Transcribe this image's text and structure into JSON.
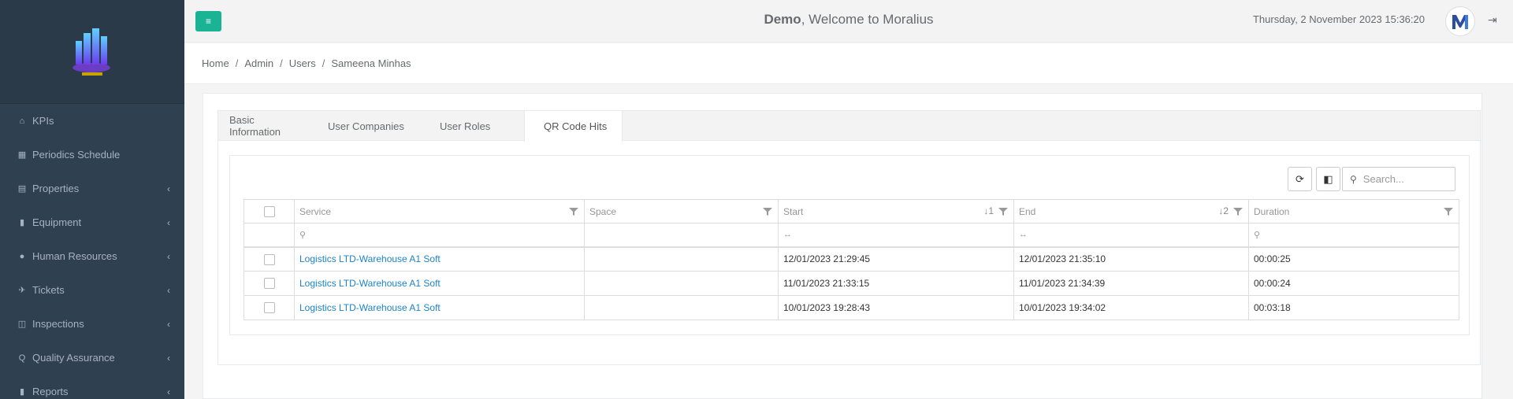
{
  "sidebar": {
    "items": [
      {
        "label": "KPIs",
        "icon": "home-icon",
        "chevron": false
      },
      {
        "label": "Periodics Schedule",
        "icon": "calendar-icon",
        "chevron": false
      },
      {
        "label": "Properties",
        "icon": "building-icon",
        "chevron": true
      },
      {
        "label": "Equipment",
        "icon": "book-icon",
        "chevron": true
      },
      {
        "label": "Human Resources",
        "icon": "users-icon",
        "chevron": true
      },
      {
        "label": "Tickets",
        "icon": "tag-icon",
        "chevron": true
      },
      {
        "label": "Inspections",
        "icon": "map-icon",
        "chevron": true
      },
      {
        "label": "Quality Assurance",
        "icon": "search-icon",
        "chevron": true
      },
      {
        "label": "Reports",
        "icon": "file-icon",
        "chevron": true
      }
    ],
    "chevron_glyph": "‹"
  },
  "header": {
    "user": "Demo",
    "welcome_rest": ", Welcome to Moralius",
    "datetime": "Thursday, 2 November 2023 15:36:20"
  },
  "breadcrumb": {
    "items": [
      "Home",
      "Admin",
      "Users",
      "Sameena Minhas"
    ],
    "separator": "/"
  },
  "tabs": [
    {
      "label": "Basic Information",
      "active": false
    },
    {
      "label": "User Companies",
      "active": false
    },
    {
      "label": "User Roles",
      "active": false
    },
    {
      "label": "QR Code Hits",
      "active": true
    }
  ],
  "grid": {
    "search_placeholder": "Search...",
    "columns": [
      {
        "label": "Service",
        "sort": ""
      },
      {
        "label": "Space",
        "sort": ""
      },
      {
        "label": "Start",
        "sort": "1"
      },
      {
        "label": "End",
        "sort": "2"
      },
      {
        "label": "Duration",
        "sort": ""
      }
    ],
    "rows": [
      {
        "service": "Logistics LTD-Warehouse A1 Soft",
        "space": "",
        "start": "12/01/2023 21:29:45",
        "end": "12/01/2023 21:35:10",
        "duration": "00:00:25"
      },
      {
        "service": "Logistics LTD-Warehouse A1 Soft",
        "space": "",
        "start": "11/01/2023 21:33:15",
        "end": "11/01/2023 21:34:39",
        "duration": "00:00:24"
      },
      {
        "service": "Logistics LTD-Warehouse A1 Soft",
        "space": "",
        "start": "10/01/2023 19:28:43",
        "end": "10/01/2023 19:34:02",
        "duration": "00:03:18"
      }
    ]
  },
  "colors": {
    "sidebar_bg": "#2f4050",
    "accent": "#1ab394",
    "link": "#1c84c6"
  }
}
